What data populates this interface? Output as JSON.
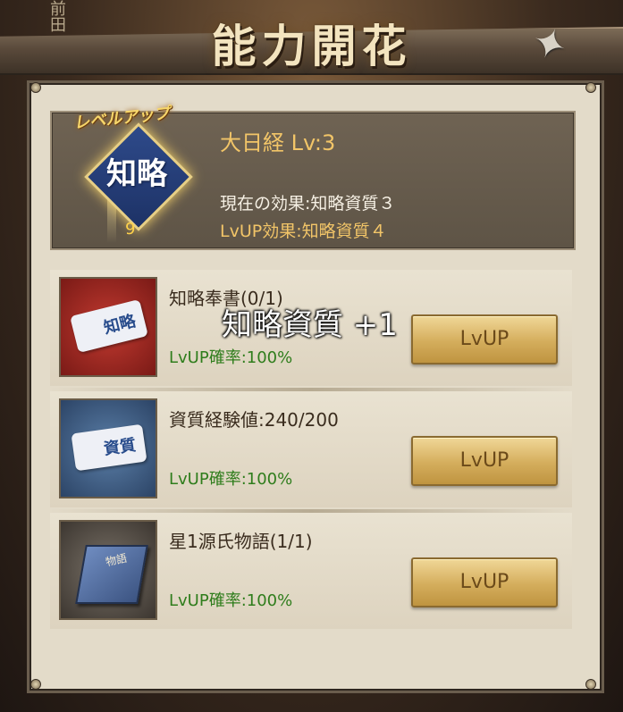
{
  "header": {
    "title": "能力開花",
    "bg_text": "前田"
  },
  "skill": {
    "levelup_badge": "レベルアップ",
    "icon_label": "知略",
    "name": "大日経 Lv:3",
    "current_effect": "現在の効果:知略資質３",
    "next_effect": "LvUP効果:知略資質４",
    "icon_number": "9"
  },
  "popup": {
    "float_text": "知略資質 +1"
  },
  "items": [
    {
      "name": "知略奉書(0/1)",
      "rate": "LvUP確率:100%",
      "button": "LvUP",
      "thumb_label": "知略"
    },
    {
      "name": "資質経験値:240/200",
      "rate": "LvUP確率:100%",
      "button": "LvUP",
      "thumb_label": "資質"
    },
    {
      "name": "星1源氏物語(1/1)",
      "rate": "LvUP確率:100%",
      "button": "LvUP",
      "thumb_label": "物語"
    }
  ],
  "icons": [
    "shuriken-icon",
    "skill-icon",
    "scroll-icon",
    "book-icon"
  ],
  "colors": {
    "accent_gold": "#f2c568",
    "rate_green": "#2f7d1c",
    "button_gold": "#d4ad5c"
  }
}
